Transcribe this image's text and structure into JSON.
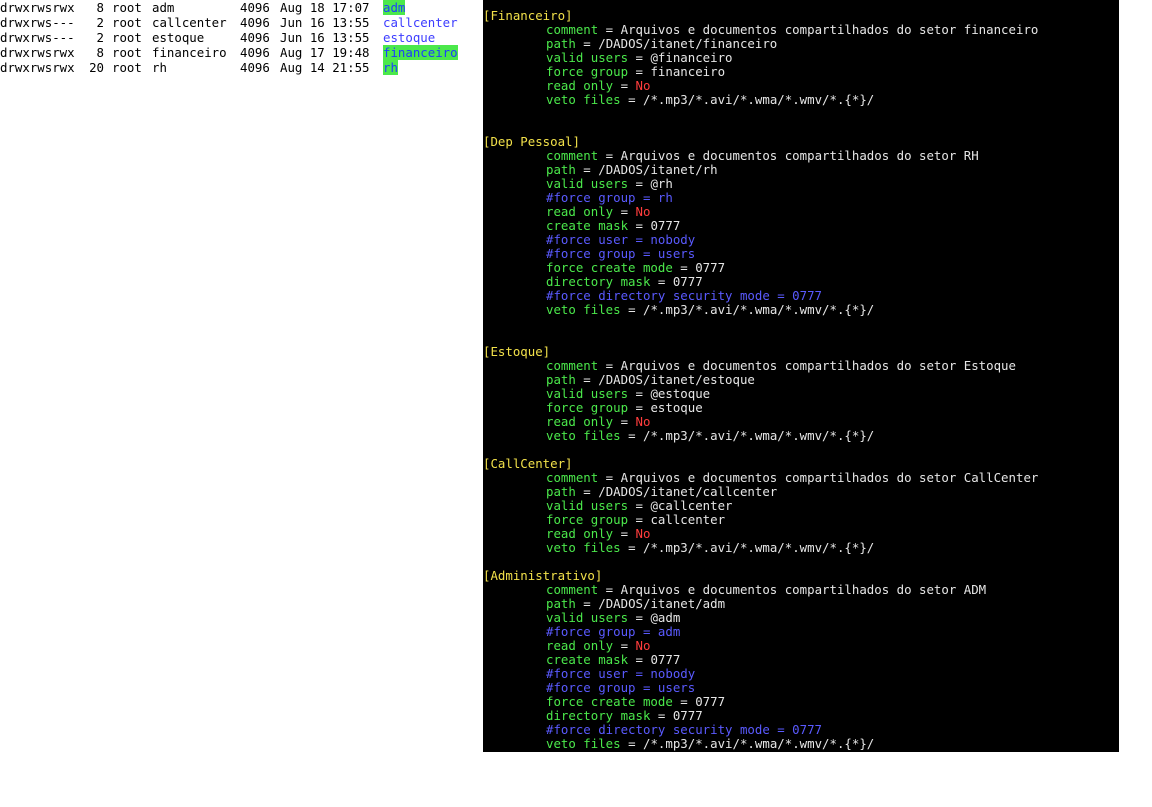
{
  "listing": {
    "rows": [
      {
        "perms": "drwxrwsrwx",
        "links": "8",
        "owner": "root",
        "group": "adm",
        "size": "4096",
        "date": "Aug 18 17:07",
        "name": "adm",
        "style": "hl"
      },
      {
        "perms": "drwxrws---",
        "links": "2",
        "owner": "root",
        "group": "callcenter",
        "size": "4096",
        "date": "Jun 16 13:55",
        "name": "callcenter",
        "style": "blue"
      },
      {
        "perms": "drwxrws---",
        "links": "2",
        "owner": "root",
        "group": "estoque",
        "size": "4096",
        "date": "Jun 16 13:55",
        "name": "estoque",
        "style": "blue"
      },
      {
        "perms": "drwxrwsrwx",
        "links": "8",
        "owner": "root",
        "group": "financeiro",
        "size": "4096",
        "date": "Aug 17 19:48",
        "name": "financeiro",
        "style": "hl"
      },
      {
        "perms": "drwxrwsrwx",
        "links": "20",
        "owner": "root",
        "group": "rh",
        "size": "4096",
        "date": "Aug 14 21:55",
        "name": "rh",
        "style": "hl"
      }
    ]
  },
  "config": {
    "lines": [
      {
        "t": "sect",
        "text": "[Financeiro]"
      },
      {
        "t": "kv",
        "k": "comment",
        "v": "Arquivos e documentos compartilhados do setor financeiro"
      },
      {
        "t": "kv",
        "k": "path",
        "v": "/DADOS/itanet/financeiro"
      },
      {
        "t": "kv",
        "k": "valid users",
        "v": "@financeiro"
      },
      {
        "t": "kv",
        "k": "force group",
        "v": "financeiro"
      },
      {
        "t": "no",
        "k": "read only",
        "v": "No"
      },
      {
        "t": "kv",
        "k": "veto files",
        "v": "/*.mp3/*.avi/*.wma/*.wmv/*.{*}/"
      },
      {
        "t": "blank"
      },
      {
        "t": "blank"
      },
      {
        "t": "sect",
        "text": "[Dep Pessoal]"
      },
      {
        "t": "kv",
        "k": "comment",
        "v": "Arquivos e documentos compartilhados do setor RH"
      },
      {
        "t": "kv",
        "k": "path",
        "v": "/DADOS/itanet/rh"
      },
      {
        "t": "kv",
        "k": "valid users",
        "v": "@rh"
      },
      {
        "t": "cmt",
        "text": "#force group = rh"
      },
      {
        "t": "no",
        "k": "read only",
        "v": "No"
      },
      {
        "t": "kv",
        "k": "create mask",
        "v": "0777"
      },
      {
        "t": "cmt",
        "text": "#force user = nobody"
      },
      {
        "t": "cmt",
        "text": "#force group = users"
      },
      {
        "t": "kv",
        "k": "force create mode",
        "v": "0777"
      },
      {
        "t": "kv",
        "k": "directory mask",
        "v": "0777"
      },
      {
        "t": "cmt",
        "text": "#force directory security mode = 0777"
      },
      {
        "t": "kv",
        "k": "veto files",
        "v": "/*.mp3/*.avi/*.wma/*.wmv/*.{*}/"
      },
      {
        "t": "blank"
      },
      {
        "t": "blank"
      },
      {
        "t": "sect",
        "text": "[Estoque]"
      },
      {
        "t": "kv",
        "k": "comment",
        "v": "Arquivos e documentos compartilhados do setor Estoque"
      },
      {
        "t": "kv",
        "k": "path",
        "v": "/DADOS/itanet/estoque"
      },
      {
        "t": "kv",
        "k": "valid users",
        "v": "@estoque"
      },
      {
        "t": "kv",
        "k": "force group",
        "v": "estoque"
      },
      {
        "t": "no",
        "k": "read only",
        "v": "No"
      },
      {
        "t": "kv",
        "k": "veto files",
        "v": "/*.mp3/*.avi/*.wma/*.wmv/*.{*}/"
      },
      {
        "t": "blank"
      },
      {
        "t": "sect",
        "text": "[CallCenter]"
      },
      {
        "t": "kv",
        "k": "comment",
        "v": "Arquivos e documentos compartilhados do setor CallCenter"
      },
      {
        "t": "kv",
        "k": "path",
        "v": "/DADOS/itanet/callcenter"
      },
      {
        "t": "kv",
        "k": "valid users",
        "v": "@callcenter"
      },
      {
        "t": "kv",
        "k": "force group",
        "v": "callcenter"
      },
      {
        "t": "no",
        "k": "read only",
        "v": "No"
      },
      {
        "t": "kv",
        "k": "veto files",
        "v": "/*.mp3/*.avi/*.wma/*.wmv/*.{*}/"
      },
      {
        "t": "blank"
      },
      {
        "t": "sect",
        "text": "[Administrativo]"
      },
      {
        "t": "kv",
        "k": "comment",
        "v": "Arquivos e documentos compartilhados do setor ADM"
      },
      {
        "t": "kv",
        "k": "path",
        "v": "/DADOS/itanet/adm"
      },
      {
        "t": "kv",
        "k": "valid users",
        "v": "@adm"
      },
      {
        "t": "cmt",
        "text": "#force group = adm"
      },
      {
        "t": "no",
        "k": "read only",
        "v": "No"
      },
      {
        "t": "kv",
        "k": "create mask",
        "v": "0777"
      },
      {
        "t": "cmt",
        "text": "#force user = nobody"
      },
      {
        "t": "cmt",
        "text": "#force group = users"
      },
      {
        "t": "kv",
        "k": "force create mode",
        "v": "0777"
      },
      {
        "t": "kv",
        "k": "directory mask",
        "v": "0777"
      },
      {
        "t": "cmt",
        "text": "#force directory security mode = 0777"
      },
      {
        "t": "kv",
        "k": "veto files",
        "v": "/*.mp3/*.avi/*.wma/*.wmv/*.{*}/"
      }
    ]
  },
  "colors": {
    "terminal_bg": "#000000",
    "section": "#f2e14a",
    "key": "#4be84b",
    "value": "#e6e6e6",
    "no": "#ff3c3c",
    "comment": "#5a5aff",
    "dir_highlight": "#4be84b",
    "dir_text": "#1c3cff"
  }
}
